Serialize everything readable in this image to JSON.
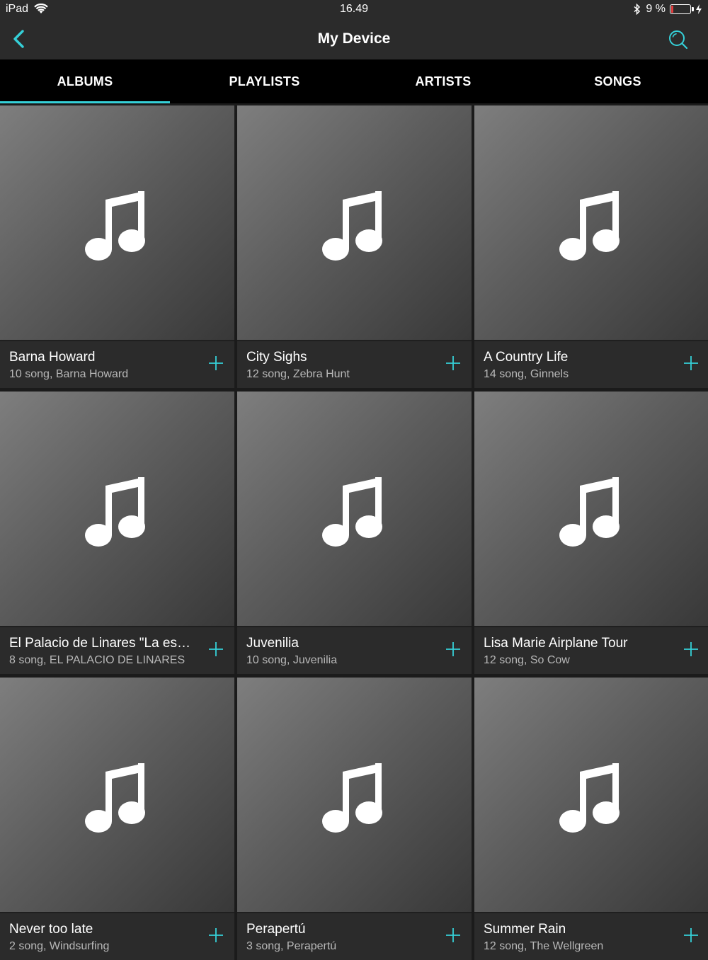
{
  "statusbar": {
    "device": "iPad",
    "time": "16.49",
    "battery": "9 %"
  },
  "navbar": {
    "title": "My Device"
  },
  "tabs": [
    {
      "label": "ALBUMS",
      "active": true
    },
    {
      "label": "PLAYLISTS",
      "active": false
    },
    {
      "label": "ARTISTS",
      "active": false
    },
    {
      "label": "SONGS",
      "active": false
    }
  ],
  "colors": {
    "accent": "#35d0d8",
    "battery_low": "#e23b3b"
  },
  "albums": [
    {
      "title": "Barna Howard",
      "subtitle": "10 song, Barna Howard"
    },
    {
      "title": "City Sighs",
      "subtitle": "12 song, Zebra Hunt"
    },
    {
      "title": "A Country Life",
      "subtitle": "14 song, Ginnels"
    },
    {
      "title": "El Palacio de Linares \"La esp...",
      "subtitle": "8 song, EL PALACIO DE LINARES"
    },
    {
      "title": "Juvenilia",
      "subtitle": "10 song, Juvenilia"
    },
    {
      "title": "Lisa Marie Airplane Tour",
      "subtitle": "12 song, So Cow"
    },
    {
      "title": "Never too late",
      "subtitle": "2 song, Windsurfing"
    },
    {
      "title": "Perapertú",
      "subtitle": "3 song, Perapertú"
    },
    {
      "title": "Summer Rain",
      "subtitle": "12 song, The Wellgreen"
    }
  ]
}
